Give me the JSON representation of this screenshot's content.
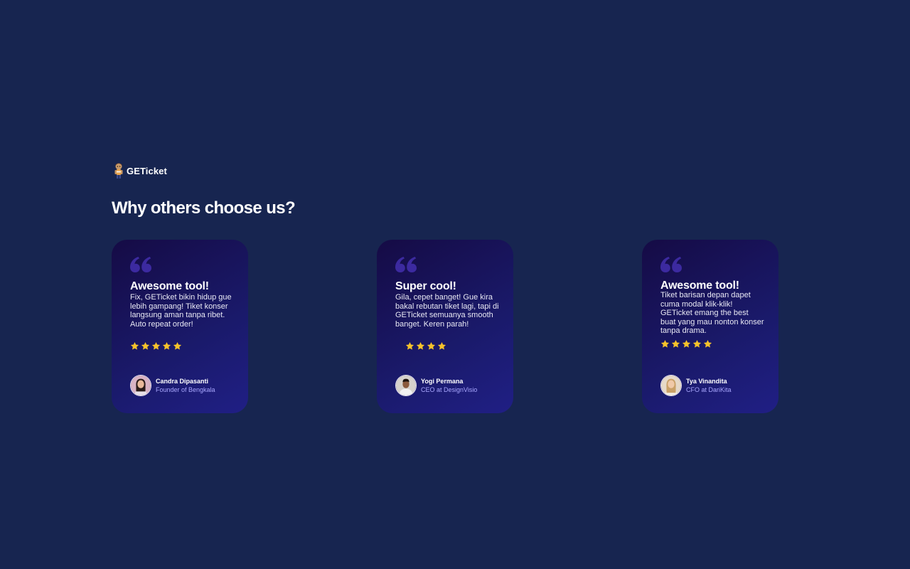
{
  "brand": {
    "name": "GETicket",
    "logo_icon": "mascot-logo-icon"
  },
  "section": {
    "heading": "Why others choose us?"
  },
  "colors": {
    "background": "#172550",
    "card_gradient_start": "#150b45",
    "card_gradient_end": "#201f85",
    "quote_mark": "#3c2aa0",
    "star": "#f6c22b",
    "role_text": "#a9a7ff"
  },
  "testimonials": [
    {
      "title": "Awesome tool!",
      "body": "Fix, GETicket bikin hidup gue lebih gampang! Tiket konser langsung aman tanpa ribet. Auto repeat order!",
      "rating": 5,
      "author": "Candra Dipasanti",
      "role": "Founder of Bengkala",
      "avatar_icon": "female-avatar-icon"
    },
    {
      "title": "Super cool!",
      "body": "Gila, cepet banget! Gue kira bakal rebutan tiket lagi, tapi di GETicket semuanya smooth banget. Keren parah!",
      "rating": 4,
      "author": "Yogi Permana",
      "role": "CEO at DesignVisio",
      "avatar_icon": "male-avatar-icon"
    },
    {
      "title": "Awesome tool!",
      "body": "Tiket barisan depan dapet cuma modal klik-klik! GETicket emang the best buat yang mau nonton konser tanpa drama.",
      "rating": 5,
      "author": "Tya Vinandita",
      "role": "CFO at DariKita",
      "avatar_icon": "female-avatar-icon"
    }
  ]
}
